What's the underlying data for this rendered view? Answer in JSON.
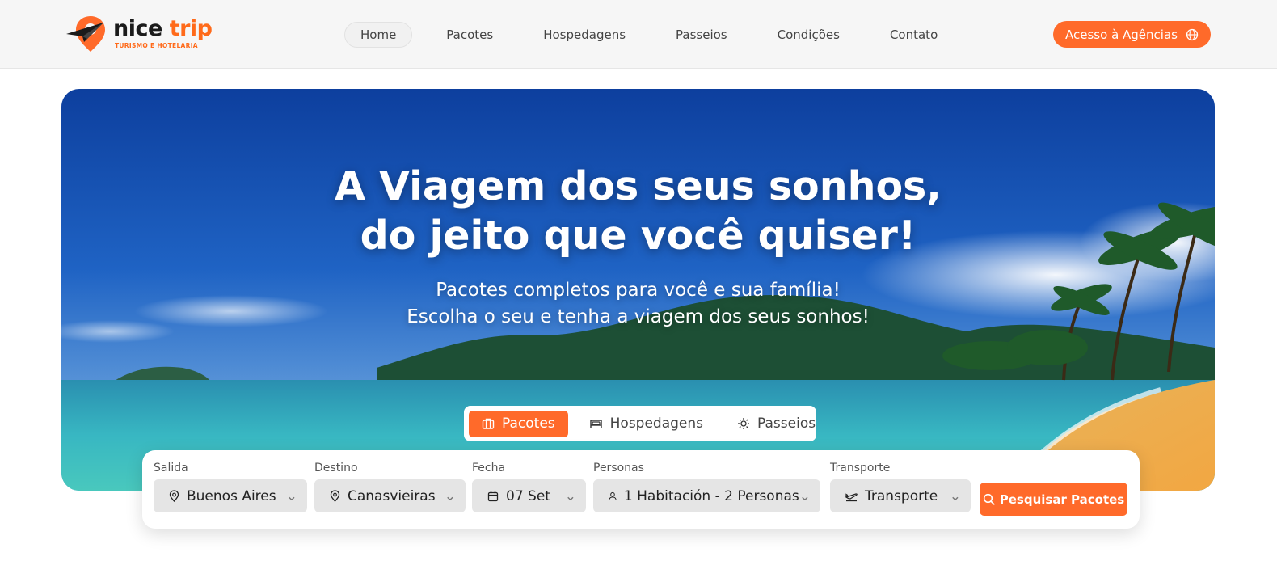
{
  "brand": {
    "name_part1": "nice ",
    "name_part2": "trip",
    "tagline": "TURISMO E HOTELARIA",
    "colors": {
      "accent": "#ff6a2a",
      "dark": "#1a1a1a"
    }
  },
  "nav": {
    "items": [
      {
        "label": "Home",
        "active": true
      },
      {
        "label": "Pacotes"
      },
      {
        "label": "Hospedagens"
      },
      {
        "label": "Passeios"
      },
      {
        "label": "Condições"
      },
      {
        "label": "Contato"
      }
    ],
    "agency_button": {
      "label": "Acesso à Agências",
      "icon": "globe-icon"
    }
  },
  "hero": {
    "title_line1": "A Viagem dos seus sonhos,",
    "title_line2": "do jeito que você quiser!",
    "subtitle_line1": "Pacotes completos para você e sua família!",
    "subtitle_line2": "Escolha o seu e tenha a viagem dos seus sonhos!"
  },
  "tabs": [
    {
      "label": "Pacotes",
      "icon": "suitcase-icon",
      "active": true
    },
    {
      "label": "Hospedagens",
      "icon": "bed-icon"
    },
    {
      "label": "Passeios",
      "icon": "sun-icon"
    }
  ],
  "search": {
    "fields": [
      {
        "label": "Salida",
        "value": "Buenos Aires",
        "icon": "location-pin-icon"
      },
      {
        "label": "Destino",
        "value": "Canasvieiras",
        "icon": "location-pin-icon"
      },
      {
        "label": "Fecha",
        "value": "07 Set",
        "icon": "calendar-icon"
      },
      {
        "label": "Personas",
        "value": "1 Habitación - 2 Personas",
        "icon": "person-icon"
      },
      {
        "label": "Transporte",
        "value": "Transporte",
        "icon": "plane-icon"
      }
    ],
    "submit_label": "Pesquisar Pacotes",
    "submit_icon": "search-icon"
  }
}
